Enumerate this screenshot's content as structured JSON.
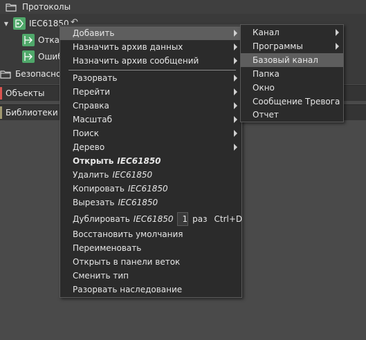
{
  "tree": {
    "protocols_label": "Протоколы",
    "iec_label": "IEC61850",
    "child1_label": "Отказ",
    "child2_label": "Ошиб",
    "security_label": "Безопаснос"
  },
  "sections": {
    "objects_label": "Объекты",
    "objects_color": "#d9534f",
    "libraries_label": "Библиотеки",
    "libraries_color": "#a09870"
  },
  "menu": {
    "add": "Добавить",
    "assign_data_archive": "Назначить архив данных",
    "assign_message_archive": "Назначить архив сообщений",
    "expand": "Разорвать",
    "goto": "Перейти",
    "help": "Справка",
    "scale": "Масштаб",
    "search": "Поиск",
    "tree": "Дерево",
    "open": "Открыть",
    "delete": "Удалить",
    "copy": "Копировать",
    "cut": "Вырезать",
    "duplicate": "Дублировать",
    "target": "IEC61850",
    "duplicate_count": "1",
    "duplicate_unit": "раз",
    "duplicate_shortcut": "Ctrl+D",
    "restore_defaults": "Восстановить умолчания",
    "rename": "Переименовать",
    "open_in_branch_panel": "Открыть в панели веток",
    "change_type": "Сменить тип",
    "break_inheritance": "Разорвать наследование"
  },
  "submenu": {
    "channel": "Канал",
    "programs": "Программы",
    "base_channel": "Базовый канал",
    "folder": "Папка",
    "window": "Окно",
    "alarm_message": "Сообщение Тревога",
    "report": "Отчет"
  }
}
